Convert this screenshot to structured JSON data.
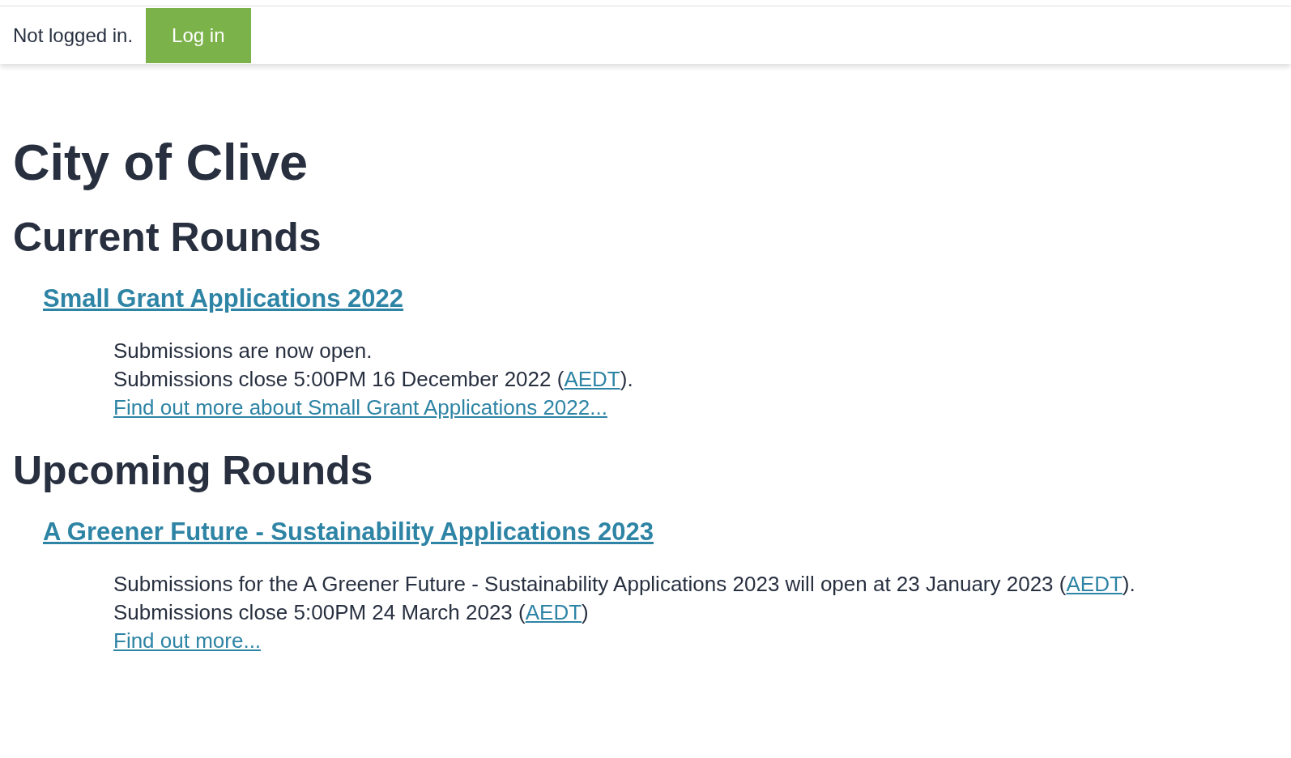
{
  "header": {
    "status": "Not logged in.",
    "login_button": "Log in"
  },
  "title": "City of Clive",
  "sections": [
    {
      "heading": "Current Rounds",
      "rounds": [
        {
          "title": "Small Grant Applications 2022",
          "lines": [
            [
              {
                "kind": "text",
                "text": "Submissions are now open."
              }
            ],
            [
              {
                "kind": "text",
                "text": "Submissions close 5:00PM 16 December 2022 ("
              },
              {
                "kind": "link",
                "text": "AEDT"
              },
              {
                "kind": "text",
                "text": ")."
              }
            ],
            [
              {
                "kind": "link",
                "text": "Find out more about Small Grant Applications 2022..."
              }
            ]
          ]
        }
      ]
    },
    {
      "heading": "Upcoming Rounds",
      "rounds": [
        {
          "title": "A Greener Future - Sustainability Applications 2023",
          "lines": [
            [
              {
                "kind": "text",
                "text": "Submissions for the A Greener Future - Sustainability Applications 2023 will open at 23 January 2023 ("
              },
              {
                "kind": "link",
                "text": "AEDT"
              },
              {
                "kind": "text",
                "text": ")."
              }
            ],
            [
              {
                "kind": "text",
                "text": "Submissions close 5:00PM 24 March 2023 ("
              },
              {
                "kind": "link",
                "text": "AEDT"
              },
              {
                "kind": "text",
                "text": ")"
              }
            ],
            [
              {
                "kind": "link",
                "text": "Find out more..."
              }
            ]
          ]
        }
      ]
    }
  ]
}
